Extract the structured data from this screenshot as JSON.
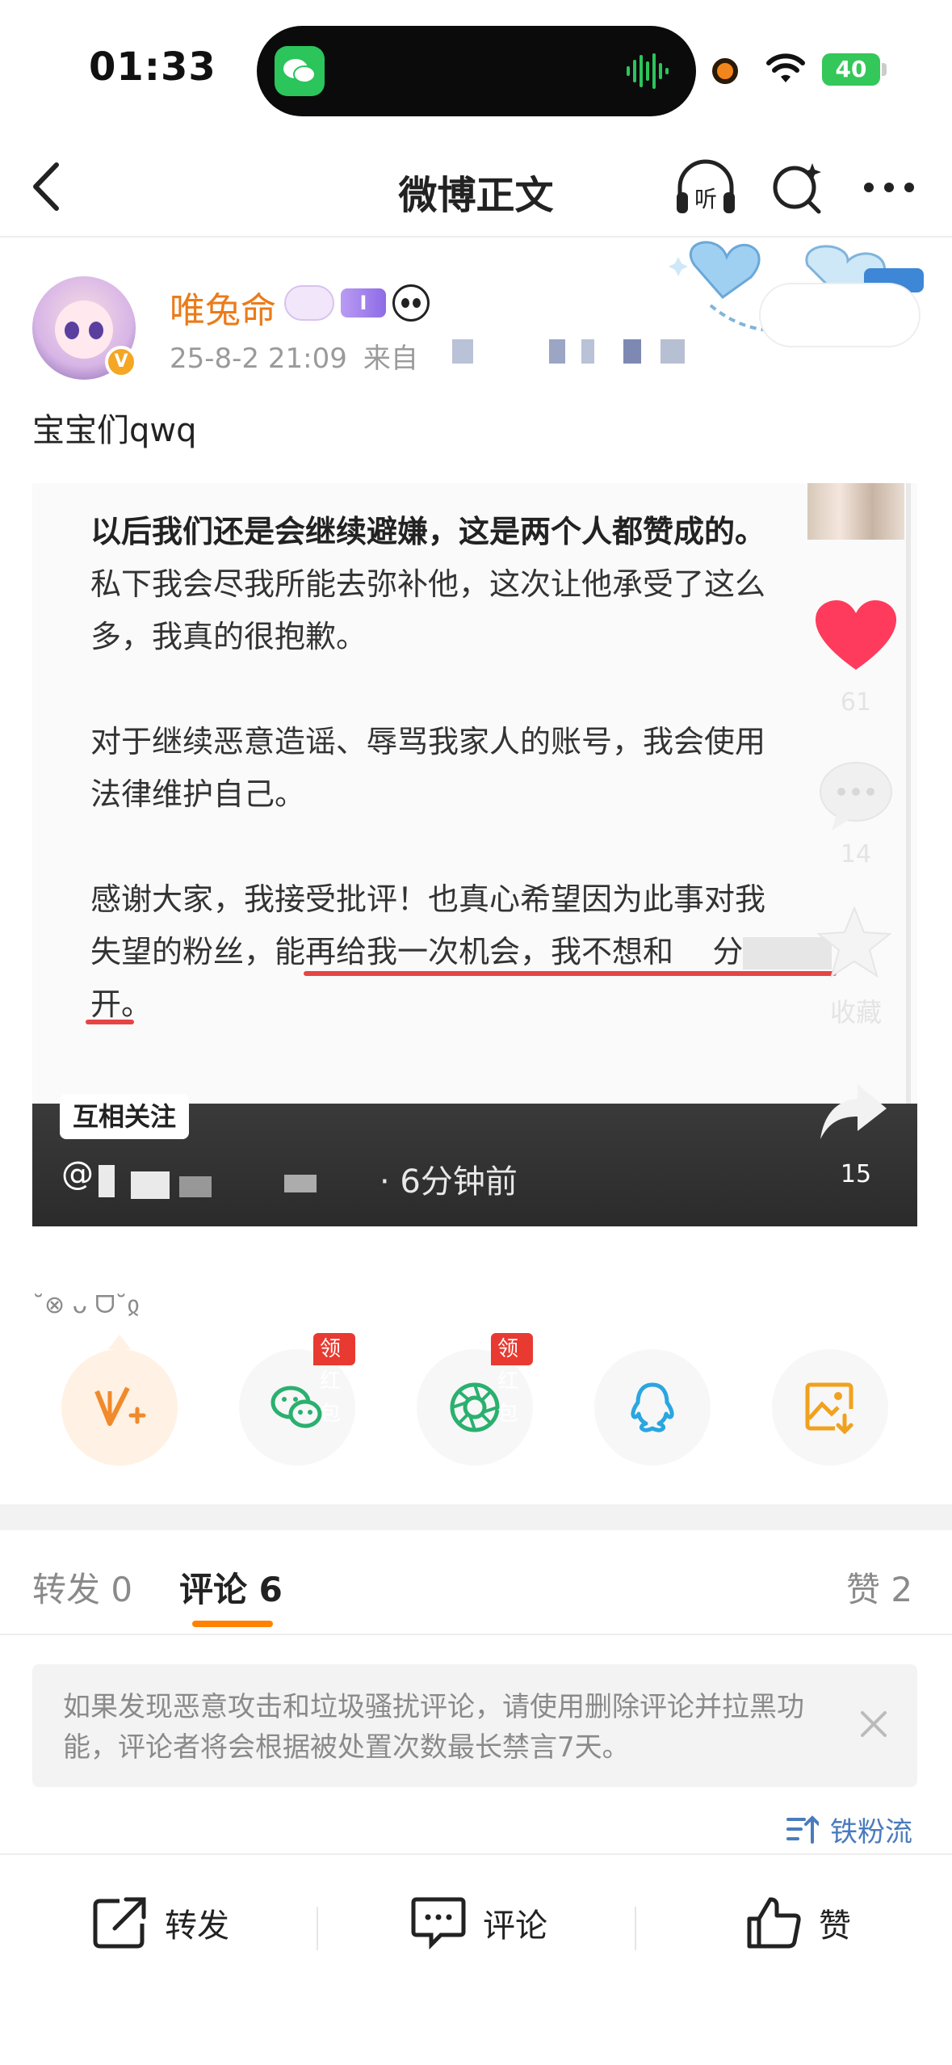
{
  "status_bar": {
    "time": "01:33",
    "battery": "40"
  },
  "nav": {
    "title": "微博正文",
    "listen_label": "听"
  },
  "post": {
    "user_name": "唯兔命",
    "level_badge": "I",
    "timestamp": "25-8-2 21:09",
    "source_prefix": "来自",
    "verified_badge": "V",
    "text": "宝宝们qwq"
  },
  "embedded": {
    "lines": [
      "以后我们还是会继续避嫌，这是两个人都赞成的。",
      "私下我会尽我所能去弥补他，这次让他承受了这么",
      "多，我真的很抱歉。",
      "对于继续恶意造谣、辱骂我家人的账号，我会使用",
      "法律维护自己。",
      "感谢大家，我接受批评！也真心希望因为此事对我",
      "失望的粉丝，能再给我一次机会，我不想和",
      "开。"
    ],
    "line6_tail": "分",
    "like_count": "61",
    "comment_count": "14",
    "collect_label": "收藏",
    "share_count": "15",
    "mutual_follow": "互相关注",
    "handle_prefix": "@",
    "handle_time": "· 6分钟前"
  },
  "emoticon": "˘⊗ ᴗ ᗜ˘ჲ",
  "share_targets": [
    {
      "name": "v-plus",
      "badge": ""
    },
    {
      "name": "wechat",
      "badge": "领红包"
    },
    {
      "name": "moments",
      "badge": "领红包"
    },
    {
      "name": "qq",
      "badge": ""
    },
    {
      "name": "save-image",
      "badge": ""
    }
  ],
  "tabs": {
    "repost": "转发 0",
    "comment": "评论 6",
    "like": "赞 2"
  },
  "notice": {
    "text": "如果发现恶意攻击和垃圾骚扰评论，请使用删除评论并拉黑功能，评论者将会根据被处置次数最长禁言7天。"
  },
  "sort_label": "铁粉流",
  "bottom_bar": {
    "repost": "转发",
    "comment": "评论",
    "like": "赞"
  },
  "colors": {
    "accent": "#ff8200",
    "name": "#eb7b19",
    "link": "#4a7bbd",
    "red_badge": "#e83a31"
  }
}
